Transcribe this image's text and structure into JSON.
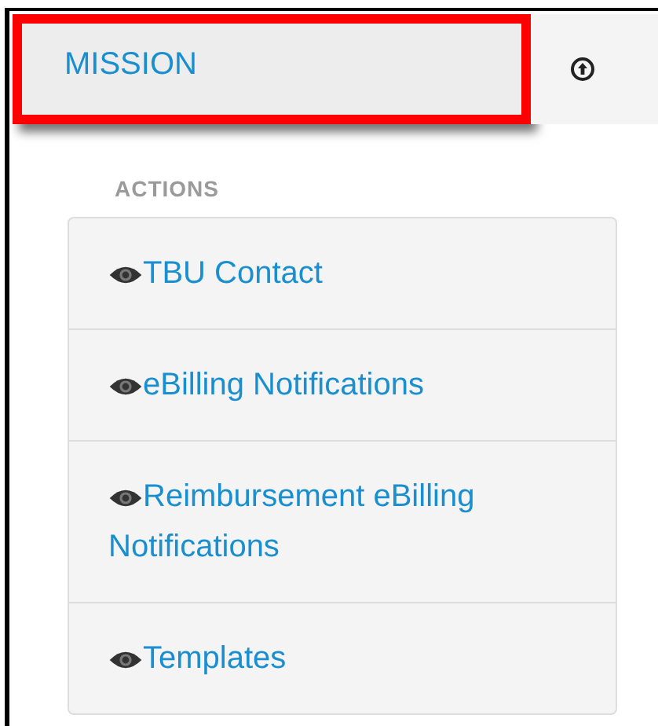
{
  "tab": {
    "label": "MISSION",
    "highlighted": true
  },
  "section_heading": "ACTIONS",
  "actions": [
    {
      "label": "TBU Contact"
    },
    {
      "label": "eBilling Notifications"
    },
    {
      "label": "Reimbursement eBilling Notifications"
    },
    {
      "label": "Templates"
    }
  ]
}
